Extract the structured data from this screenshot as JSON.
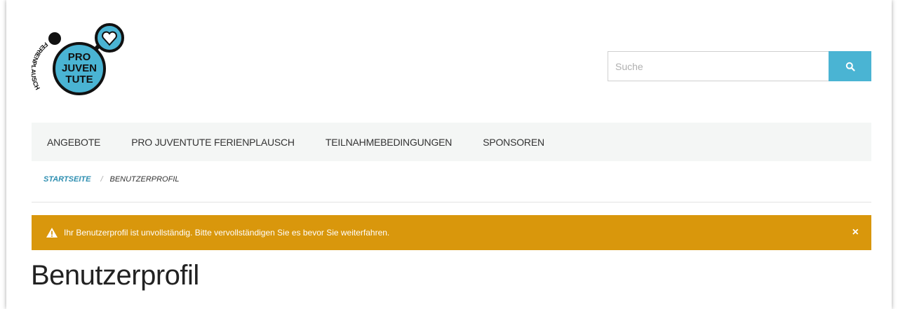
{
  "logo": {
    "line1": "PRO",
    "line2": "JUVEN",
    "line3": "TUTE",
    "arc_text": "FERIENPLAUSCH",
    "accent_color": "#4ab4d3"
  },
  "search": {
    "placeholder": "Suche",
    "button_icon": "search-icon",
    "button_color": "#4ab4d3"
  },
  "nav": {
    "items": [
      {
        "label": "ANGEBOTE"
      },
      {
        "label": "PRO JUVENTUTE FERIENPLAUSCH"
      },
      {
        "label": "TEILNAHMEBEDINGUNGEN"
      },
      {
        "label": "SPONSOREN"
      }
    ]
  },
  "breadcrumb": {
    "home": "STARTSEITE",
    "separator": "/",
    "current": "BENUTZERPROFIL"
  },
  "alert": {
    "icon": "warning-icon",
    "message": "Ihr Benutzerprofil ist unvollständig. Bitte vervollständigen Sie es bevor Sie weiterfahren.",
    "close": "×",
    "color": "#d9970c"
  },
  "page": {
    "title": "Benutzerprofil"
  }
}
